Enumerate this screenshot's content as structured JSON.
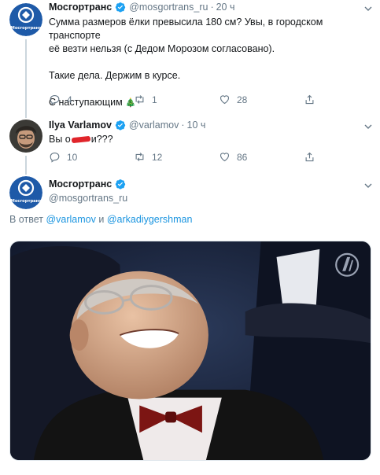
{
  "tweet1": {
    "name": "Мосгортранс",
    "handle": "@mosgortrans_ru",
    "time": "20 ч",
    "avatar_label": "Мосгортранс",
    "lines": [
      "Сумма размеров ёлки превысила 180 см? Увы, в городском транспорте",
      "её везти нельзя (с Дедом Морозом согласовано).",
      "Такие дела. Держим в курсе.",
      "С наступающим"
    ],
    "emoji": "🎄",
    "replies": "4",
    "retweets": "1",
    "likes": "28"
  },
  "tweet2": {
    "name": "Ilya Varlamov",
    "handle": "@varlamov",
    "time": "10 ч",
    "text_start": "Вы о",
    "text_end": "и???",
    "replies": "10",
    "retweets": "12",
    "likes": "86"
  },
  "tweet3": {
    "name": "Мосгортранс",
    "handle": "@mosgortrans_ru",
    "reply_prefix": "В ответ",
    "mention1": "@varlamov",
    "and": "и",
    "mention2": "@arkadiygershman"
  },
  "colors": {
    "accent": "#1da1f2",
    "brand": "#1e5aa8",
    "muted": "#657786",
    "censor": "#e0252b"
  },
  "icons": [
    "verified-icon",
    "caret-down-icon",
    "reply-icon",
    "retweet-icon",
    "like-icon",
    "share-icon",
    "channel-one-logo-icon"
  ]
}
